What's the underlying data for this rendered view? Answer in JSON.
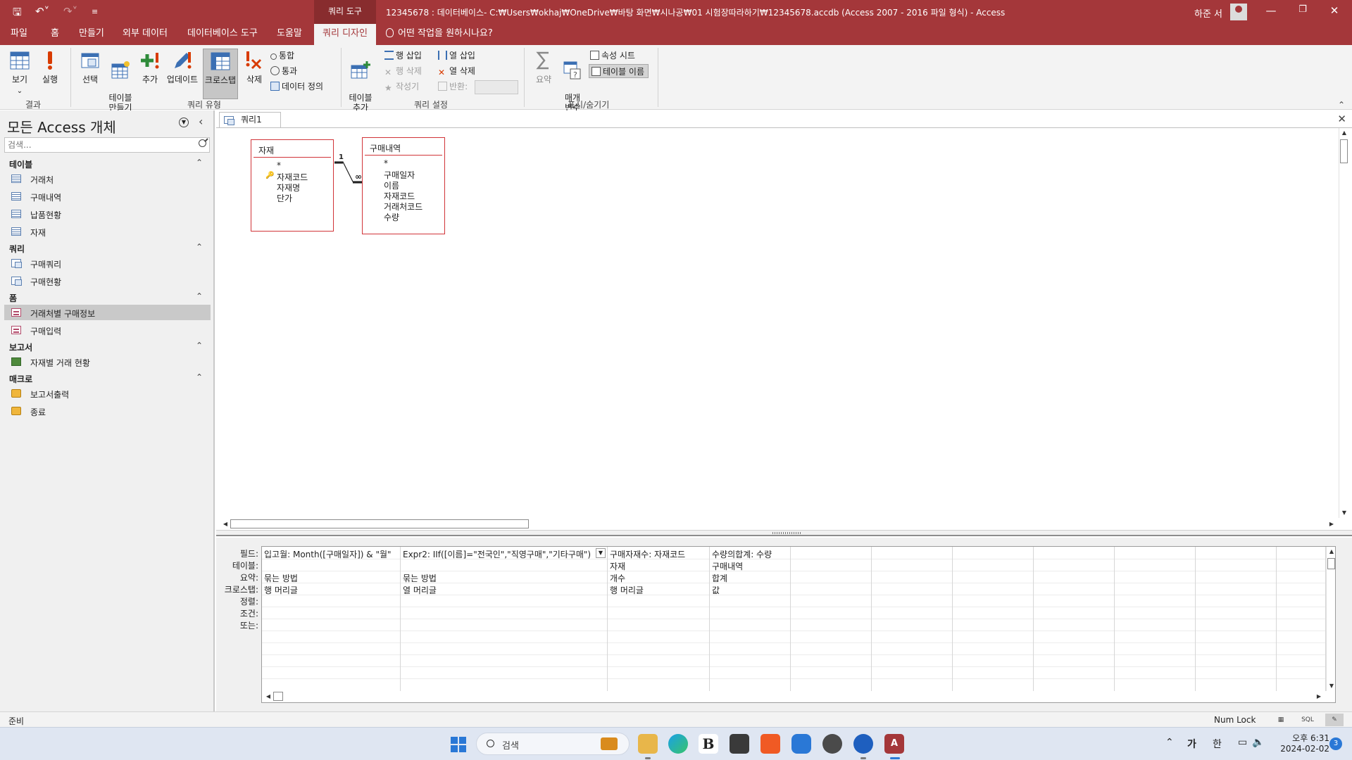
{
  "titlebar": {
    "context_tab": "쿼리 도구",
    "title": "12345678 : 데이터베이스- C:₩Users₩okhaj₩OneDrive₩바탕 화면₩시나공₩01 시험장따라하기₩12345678.accdb (Access 2007 - 2016 파일 형식)  -  Access",
    "user": "하준 서"
  },
  "menu": {
    "tabs": [
      "파일",
      "홈",
      "만들기",
      "외부 데이터",
      "데이터베이스 도구",
      "도움말",
      "쿼리 디자인"
    ],
    "active": "쿼리 디자인",
    "tell_me": "어떤 작업을 원하시나요?"
  },
  "ribbon": {
    "results": {
      "label": "결과",
      "view": "보기",
      "view_arrow": "⌄",
      "run": "실행"
    },
    "query_type": {
      "label": "쿼리 유형",
      "select": "선택",
      "make_table": "테이블\n만들기",
      "append": "추가",
      "update": "업데이트",
      "crosstab": "크로스탭",
      "delete": "삭제",
      "union": "통합",
      "passthrough": "통과",
      "data_definition": "데이터 정의"
    },
    "query_setup": {
      "label": "쿼리 설정",
      "add_tables": "테이블\n추가",
      "insert_rows": "행 삽입",
      "delete_rows": "행 삭제",
      "builder": "작성기",
      "insert_columns": "열 삽입",
      "delete_columns": "열 삭제",
      "return": "반환:"
    },
    "show_hide": {
      "label": "표시/숨기기",
      "totals": "요약",
      "parameters": "매개\n변수",
      "property_sheet": "속성 시트",
      "table_names": "테이블 이름"
    }
  },
  "nav": {
    "title": "모든 Access 개체",
    "search_placeholder": "검색...",
    "groups": [
      {
        "name": "테이블",
        "items": [
          "거래처",
          "구매내역",
          "납품현황",
          "자재"
        ]
      },
      {
        "name": "쿼리",
        "items": [
          "구매쿼리",
          "구매현황"
        ]
      },
      {
        "name": "폼",
        "items": [
          "거래처별 구매정보",
          "구매입력"
        ]
      },
      {
        "name": "보고서",
        "items": [
          "자재별 거래 현황"
        ]
      },
      {
        "name": "매크로",
        "items": [
          "보고서출력",
          "종료"
        ]
      }
    ],
    "selected": "거래처별 구매정보"
  },
  "doc": {
    "tab": "쿼리1",
    "tables": [
      {
        "title": "자재",
        "fields": [
          "*",
          "자재코드",
          "자재명",
          "단가"
        ],
        "key_field": "자재코드"
      },
      {
        "title": "구매내역",
        "fields": [
          "*",
          "구매일자",
          "이름",
          "자재코드",
          "거래처코드",
          "수량"
        ]
      }
    ],
    "relation": {
      "one": "1",
      "many": "∞"
    }
  },
  "qbe": {
    "row_labels": [
      "필드:",
      "테이블:",
      "요약:",
      "크로스탭:",
      "정렬:",
      "조건:",
      "또는:"
    ],
    "columns": [
      {
        "field": "입고월: Month([구매일자]) & \"월\"",
        "table": "",
        "total": "묶는 방법",
        "crosstab": "행 머리글"
      },
      {
        "field": "Expr2: IIf([이름]=\"전국인\",\"직영구매\",\"기타구매\")",
        "table": "",
        "total": "묶는 방법",
        "crosstab": "열 머리글"
      },
      {
        "field": "구매자재수: 자재코드",
        "table": "자재",
        "total": "개수",
        "crosstab": "행 머리글"
      },
      {
        "field": "수량의합계: 수량",
        "table": "구매내역",
        "total": "합계",
        "crosstab": "값"
      }
    ]
  },
  "status": {
    "text": "준비",
    "numlock": "Num Lock",
    "sql": "SQL"
  },
  "taskbar": {
    "search": "검색",
    "tray": {
      "ime_ga": "가",
      "ime_han": "한",
      "time": "오후 6:31",
      "date": "2024-02-02",
      "notifications": "3"
    }
  },
  "colors": {
    "accent": "#a4373a",
    "table_border": "#d13438",
    "taskbar": "#dfe6f2"
  }
}
